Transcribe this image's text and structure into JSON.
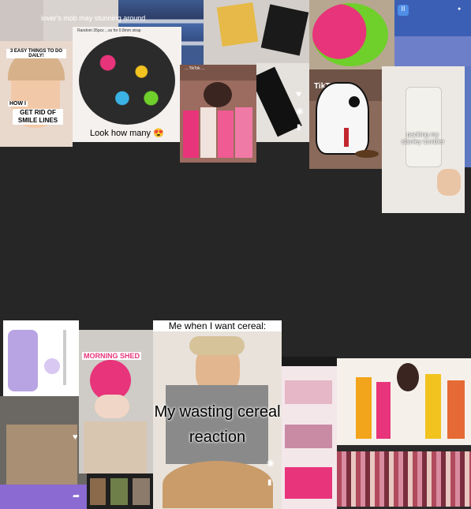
{
  "tiles": {
    "shoes": {
      "caption": "lover's mob may stunning around"
    },
    "skincare": {
      "top_caption": "3 EASY THINGS TO DO DAILY!",
      "mid_caption": "HOW I",
      "big_caption": "GET RID OF SMILE LINES"
    },
    "charms": {
      "note": "Random 35pcs ...ss for 0.8mm strap",
      "caption": "Look how many 😍"
    },
    "stanley_cups": {
      "caption": "... TikTok ..."
    },
    "tiktok_griffin": {
      "logo": "TikTok"
    },
    "stanley_tumbler": {
      "caption": "packing my stanley tumbler"
    },
    "morning_shed": {
      "caption": "MORNING SHED"
    },
    "cereal": {
      "top_caption": "Me when I want cereal:",
      "big_caption": "My wasting cereal reaction"
    }
  },
  "colors": {
    "background": "#262626",
    "pink": "#e8347a",
    "lavender": "#b8a4e3",
    "green": "#6fcf2b"
  }
}
